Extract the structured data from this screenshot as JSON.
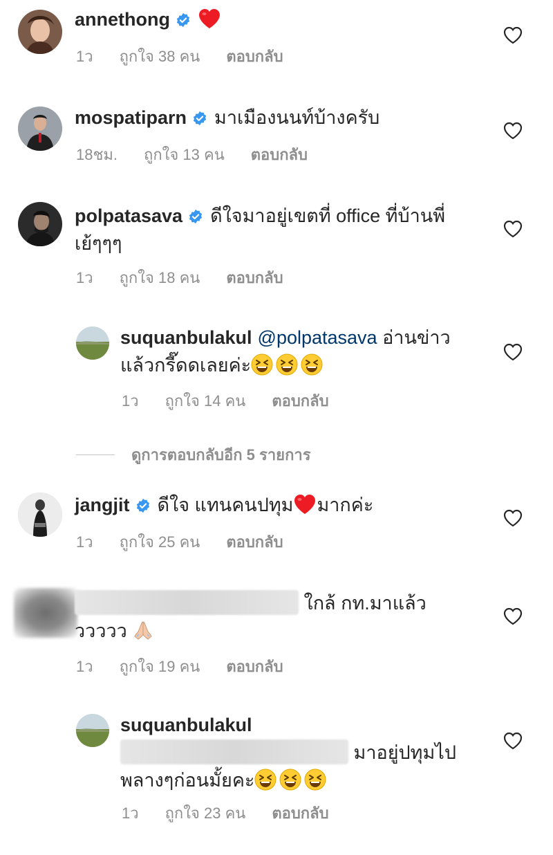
{
  "comments": [
    {
      "username": "annethong",
      "text": "",
      "time": "1ว",
      "likes": "ถูกใจ 38 คน",
      "reply": "ตอบกลับ",
      "verified": true,
      "trailing_emoji": "red-heart"
    },
    {
      "username": "mospatiparn",
      "text": "มาเมืองนนท์บ้างครับ",
      "time": "18ชม.",
      "likes": "ถูกใจ 13 คน",
      "reply": "ตอบกลับ",
      "verified": true
    },
    {
      "username": "polpatasava",
      "text_line1": "ดีใจมาอยู่เขตที่ office ที่บ้านพี่",
      "text_line2": "เย้ๆๆๆ",
      "time": "1ว",
      "likes": "ถูกใจ 18 คน",
      "reply": "ตอบกลับ",
      "verified": true
    },
    {
      "username": "suquanbulakul",
      "mention": "@polpatasava",
      "text_line1": "อ่านข่าว",
      "text_line2": "แล้วกรี๊ดดเลยค่ะ",
      "time": "1ว",
      "likes": "ถูกใจ 14 คน",
      "reply": "ตอบกลับ",
      "verified": false,
      "trailing_emoji": "laughing-face x3"
    },
    {
      "username": "jangjit",
      "text_before": "ดีใจ แทนคนปทุม",
      "text_after": "มากค่ะ",
      "time": "1ว",
      "likes": "ถูกใจ 25 คน",
      "reply": "ตอบกลับ",
      "verified": true
    },
    {
      "username": "",
      "text_line1": "ใกล้ กท.มาแล้ว",
      "text_line2": "ววววว",
      "time": "1ว",
      "likes": "ถูกใจ 19 คน",
      "reply": "ตอบกลับ",
      "verified": false,
      "trailing_emoji": "folded-hands"
    },
    {
      "username": "suquanbulakul",
      "text_line1": "มาอยู่ปทุมไป",
      "text_line2": "พลางๆก่อนมั้ยคะ",
      "time": "1ว",
      "likes": "ถูกใจ 23 คน",
      "reply": "ตอบกลับ",
      "verified": false,
      "trailing_emoji": "laughing-face x3"
    }
  ],
  "view_replies": "ดูการตอบกลับอีก 5 รายการ",
  "colors": {
    "text": "#262626",
    "meta": "#8e8e8e",
    "verified": "#3897f0",
    "mention": "#00376b",
    "heart": "#ed1c24"
  },
  "icons": [
    "verified-badge-icon",
    "heart-outline-icon",
    "red-heart-emoji",
    "laughing-face-emoji",
    "folded-hands-emoji"
  ]
}
